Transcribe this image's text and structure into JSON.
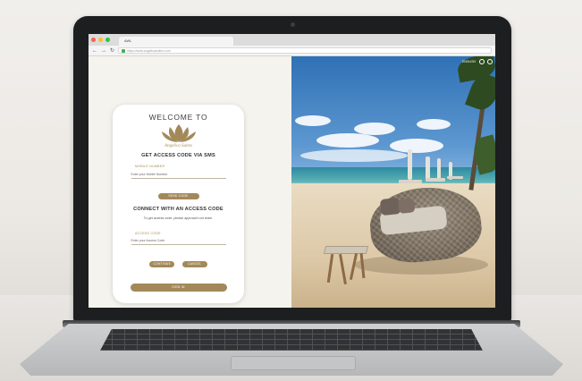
{
  "browser": {
    "tab_title": "AWL",
    "url": "https://www.angelicasuites.com",
    "traffic_lights": [
      "#ff5f57",
      "#febc2e",
      "#28c840"
    ]
  },
  "login": {
    "welcome": "WELCOME TO",
    "brand_name": "Angelica Suites",
    "sms_title": "GET ACCESS CODE VIA SMS",
    "mobile_label": "MOBILE NUMBER",
    "mobile_placeholder": "Enter your Mobile Number",
    "send_code": "SEND CODE",
    "access_title": "CONNECT WITH AN ACCESS CODE",
    "access_info": "To get access code, please approach our team.",
    "access_label": "ACCESS CODE",
    "access_placeholder": "Enter your Access Code",
    "continue": "CONTINUE",
    "cancel": "CANCEL",
    "sign_in": "SIGN IN"
  },
  "hero": {
    "language": "ENGLISH",
    "icons": [
      "info-icon",
      "help-icon"
    ]
  },
  "colors": {
    "accent_gold": "#a3895a",
    "lid": "#1d1e20"
  }
}
